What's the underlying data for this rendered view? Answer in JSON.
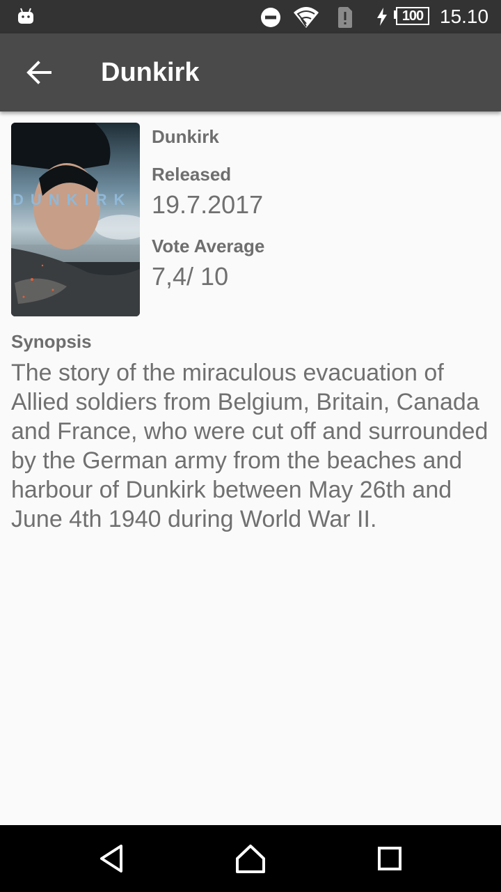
{
  "status_bar": {
    "icons": [
      "android-icon",
      "do-not-disturb-icon",
      "wifi-icon",
      "sim-alert-icon",
      "charging-icon",
      "battery-icon"
    ],
    "battery_level": "100",
    "time": "15.10"
  },
  "app_bar": {
    "title": "Dunkirk",
    "back_icon": "arrow-back-icon"
  },
  "movie": {
    "poster_text": "DUNKIRK",
    "title": "Dunkirk",
    "released_label": "Released",
    "released_value": "19.7.2017",
    "vote_label": "Vote Average",
    "vote_value": "7,4/ 10",
    "synopsis_label": "Synopsis",
    "synopsis_text": "The story of the miraculous evacuation of Allied soldiers from Belgium, Britain, Canada and France, who were cut off and surrounded by the German army from the beaches and harbour of Dunkirk between May 26th and June 4th 1940 during World War II."
  },
  "nav_bar": {
    "icons": [
      "back-triangle-icon",
      "home-icon",
      "recents-icon"
    ]
  },
  "colors": {
    "status_bar": "#333333",
    "app_bar": "#4a4a4a",
    "background": "#fafafa",
    "label_text": "#6e6e6e",
    "value_text": "#707070",
    "nav_bar": "#000000"
  }
}
